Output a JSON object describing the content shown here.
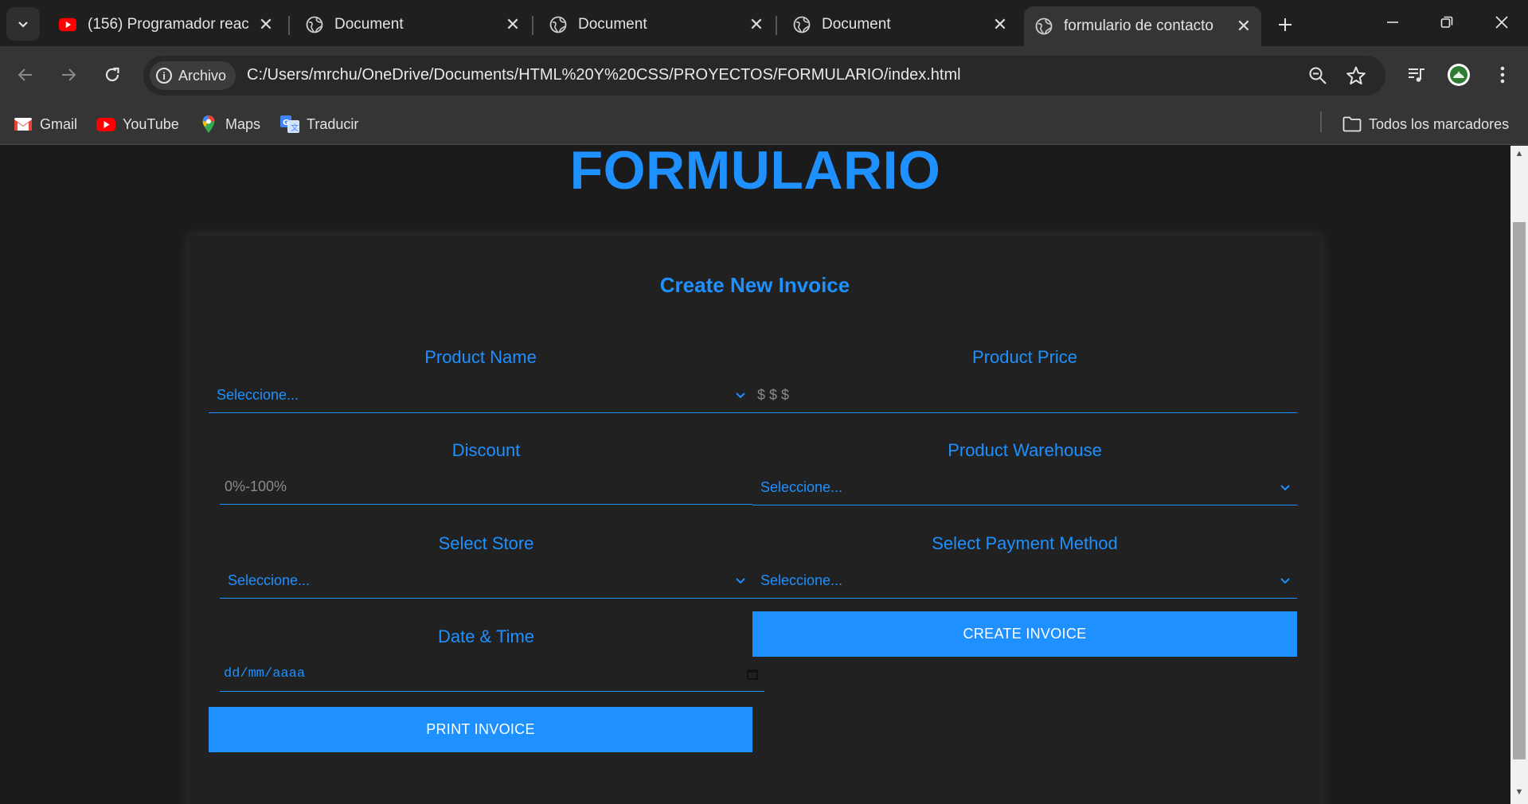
{
  "browser": {
    "tabs": [
      {
        "title": "(156) Programador reac",
        "favicon": "youtube-icon",
        "active": false
      },
      {
        "title": "Document",
        "favicon": "globe-icon",
        "active": false
      },
      {
        "title": "Document",
        "favicon": "globe-icon",
        "active": false
      },
      {
        "title": "Document",
        "favicon": "globe-icon",
        "active": false
      },
      {
        "title": "formulario de contacto",
        "favicon": "globe-icon",
        "active": true
      }
    ],
    "address": {
      "chip_label": "Archivo",
      "url": "C:/Users/mrchu/OneDrive/Documents/HTML%20Y%20CSS/PROYECTOS/FORMULARIO/index.html"
    },
    "bookmarks": [
      {
        "label": "Gmail",
        "icon": "gmail-icon"
      },
      {
        "label": "YouTube",
        "icon": "youtube-icon"
      },
      {
        "label": "Maps",
        "icon": "maps-icon"
      },
      {
        "label": "Traducir",
        "icon": "translate-icon"
      }
    ],
    "all_bookmarks_label": "Todos los marcadores"
  },
  "page": {
    "heading": "FORMULARIO",
    "form": {
      "title": "Create New Invoice",
      "product_name": {
        "label": "Product Name",
        "value": "Seleccione..."
      },
      "product_price": {
        "label": "Product Price",
        "placeholder": "$ $ $"
      },
      "discount": {
        "label": "Discount",
        "placeholder": "0%-100%"
      },
      "product_warehouse": {
        "label": "Product Warehouse",
        "value": "Seleccione..."
      },
      "select_store": {
        "label": "Select Store",
        "value": "Seleccione..."
      },
      "payment_method": {
        "label": "Select Payment Method",
        "value": "Seleccione..."
      },
      "date_time": {
        "label": "Date & Time",
        "placeholder": "dd/mm/aaaa"
      },
      "create_button": "CREATE INVOICE",
      "print_button": "PRINT INVOICE"
    }
  },
  "colors": {
    "accent": "#1e90ff",
    "page_background": "#1b1b1b",
    "card_background": "#212121"
  }
}
